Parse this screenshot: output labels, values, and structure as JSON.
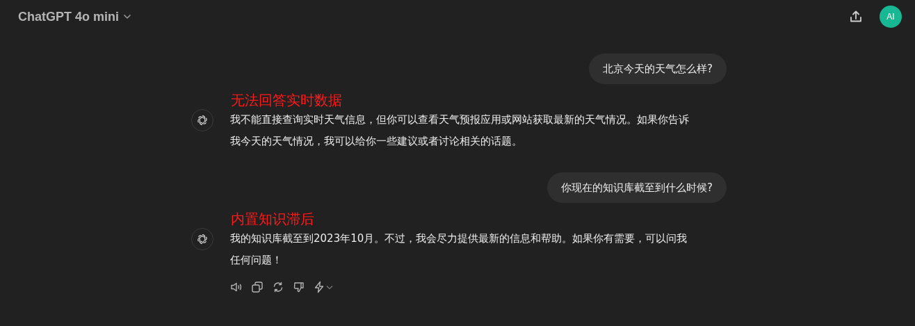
{
  "header": {
    "model": "ChatGPT 4o mini",
    "avatar": "AI"
  },
  "messages": [
    {
      "kind": "user",
      "text": "北京今天的天气怎么样?"
    },
    {
      "kind": "assistant",
      "annotation": "无法回答实时数据",
      "text": "我不能直接查询实时天气信息，但你可以查看天气预报应用或网站获取最新的天气情况。如果你告诉我今天的天气情况，我可以给你一些建议或者讨论相关的话题。"
    },
    {
      "kind": "user",
      "text": "你现在的知识库截至到什么时候?"
    },
    {
      "kind": "assistant",
      "annotation": "内置知识滞后",
      "text": "我的知识库截至到2023年10月。不过，我会尽力提供最新的信息和帮助。如果你有需要，可以问我任何问题！"
    }
  ]
}
